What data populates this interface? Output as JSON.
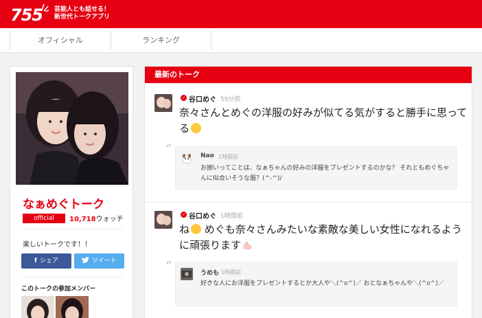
{
  "header": {
    "logo": "755",
    "tagline_line1": "芸能人とも話せる！",
    "tagline_line2": "新世代トークアプリ",
    "brand_color": "#e60012"
  },
  "nav": {
    "items": [
      {
        "label": "オフィシャル"
      },
      {
        "label": "ランキング"
      }
    ]
  },
  "sidebar": {
    "talk_title": "なぁめぐトーク",
    "official_label": "official",
    "watch_count": "10,718",
    "watch_label": "ウォッチ",
    "description": "楽しいトークです！！",
    "share_icon": "f",
    "share_label": "シェア",
    "tweet_icon": "twitter-bird-icon",
    "tweet_label": "ツイート",
    "members_title": "このトークの参加メンバー"
  },
  "main": {
    "title": "最新のトーク",
    "posts": [
      {
        "poster": "谷口めぐ",
        "time": "59分前",
        "message": "奈々さんとめぐの洋服の好みが似てる気がすると勝手に思ってる",
        "reply": {
          "name": "Nao",
          "time": "1時間前",
          "text": "お揃いってことは、なぁちゃんの好みの洋服をプレゼントするのかな？ それともめぐちゃんに似合いそうな服？(^-^)/"
        }
      },
      {
        "poster": "谷口めぐ",
        "time": "1時間前",
        "message_part1": "ね",
        "message_part2": "めぐも奈々さんみたいな素敵な美しい女性になれるように頑張ります",
        "reply": {
          "name": "うめも",
          "time": "1時間前",
          "text": "好きな人にお洋服をプレゼントするとか大人や＼(^o^)／ おとなぁちゃんや＼(^o^)／"
        }
      }
    ]
  }
}
